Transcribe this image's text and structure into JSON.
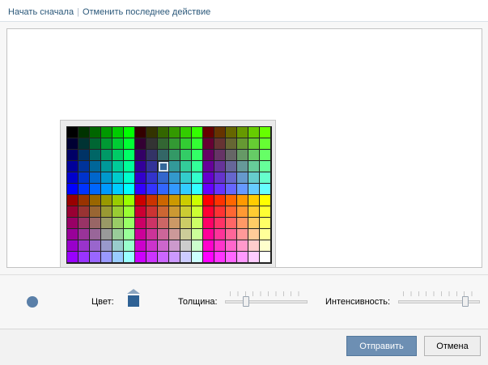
{
  "topbar": {
    "restart_label": "Начать сначала",
    "undo_label": "Отменить последнее действие"
  },
  "palette": {
    "selected": {
      "row": 3,
      "col": 8
    }
  },
  "toolbar": {
    "color_label": "Цвет:",
    "current_color": "#2e6194",
    "brush_color": "#5a7fa8",
    "thickness_label": "Толщина:",
    "thickness_value": 0.2,
    "intensity_label": "Интенсивность:",
    "intensity_value": 0.9
  },
  "footer": {
    "submit_label": "Отправить",
    "cancel_label": "Отмена"
  }
}
